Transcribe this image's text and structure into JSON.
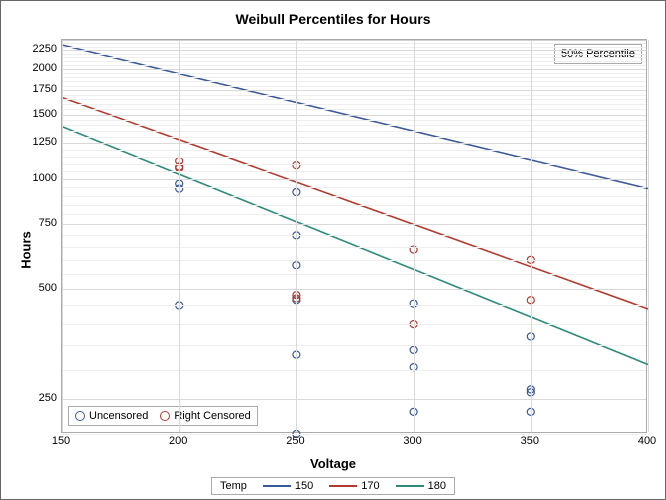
{
  "chart_data": {
    "type": "scatter",
    "title": "Weibull Percentiles for Hours",
    "xlabel": "Voltage",
    "ylabel": "Hours",
    "inset": "50% Percentile",
    "xlim": [
      150,
      400
    ],
    "ylim": [
      200,
      2400
    ],
    "yscale": "log",
    "x_ticks": [
      150,
      200,
      250,
      300,
      350,
      400
    ],
    "y_ticks": [
      250,
      500,
      750,
      1000,
      1250,
      1500,
      1750,
      2000,
      2250
    ],
    "series_lines": [
      {
        "name": "150",
        "color": "#3b5998",
        "points": [
          [
            150,
            2325
          ],
          [
            400,
            940
          ]
        ]
      },
      {
        "name": "170",
        "color": "#b23a2e",
        "points": [
          [
            150,
            1670
          ],
          [
            400,
            440
          ]
        ]
      },
      {
        "name": "180",
        "color": "#2e8b7a",
        "points": [
          [
            150,
            1390
          ],
          [
            400,
            310
          ]
        ]
      }
    ],
    "line_legend_title": "Temp",
    "point_legend": [
      {
        "name": "Uncensored",
        "color": "#3b5998"
      },
      {
        "name": "Right Censored",
        "color": "#b23a2e"
      }
    ],
    "points_uncensored": [
      [
        200,
        970
      ],
      [
        200,
        940
      ],
      [
        200,
        450
      ],
      [
        250,
        920
      ],
      [
        250,
        700
      ],
      [
        250,
        580
      ],
      [
        250,
        465
      ],
      [
        250,
        330
      ],
      [
        250,
        200
      ],
      [
        300,
        455
      ],
      [
        300,
        340
      ],
      [
        300,
        305
      ],
      [
        300,
        230
      ],
      [
        350,
        370
      ],
      [
        350,
        265
      ],
      [
        350,
        260
      ],
      [
        350,
        230
      ]
    ],
    "points_censored": [
      [
        200,
        1120
      ],
      [
        200,
        1080
      ],
      [
        200,
        1070
      ],
      [
        250,
        1090
      ],
      [
        250,
        480
      ],
      [
        250,
        470
      ],
      [
        300,
        640
      ],
      [
        300,
        400
      ],
      [
        350,
        600
      ],
      [
        350,
        465
      ]
    ]
  }
}
